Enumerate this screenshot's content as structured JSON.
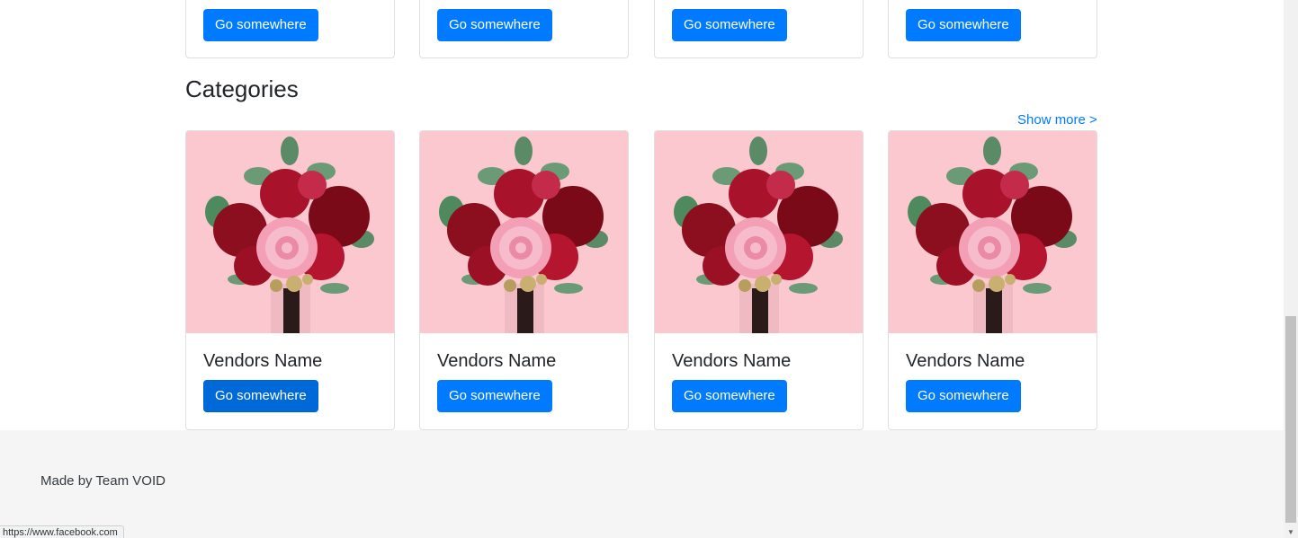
{
  "top_row": {
    "cards": [
      {
        "button": "Go somewhere"
      },
      {
        "button": "Go somewhere"
      },
      {
        "button": "Go somewhere"
      },
      {
        "button": "Go somewhere"
      }
    ]
  },
  "categories": {
    "title": "Categories",
    "show_more": "Show more >",
    "cards": [
      {
        "name": "Vendors Name",
        "button": "Go somewhere",
        "image": "flower-bouquet-image"
      },
      {
        "name": "Vendors Name",
        "button": "Go somewhere",
        "image": "flower-bouquet-image"
      },
      {
        "name": "Vendors Name",
        "button": "Go somewhere",
        "image": "flower-bouquet-image"
      },
      {
        "name": "Vendors Name",
        "button": "Go somewhere",
        "image": "flower-bouquet-image"
      }
    ]
  },
  "footer": {
    "credit": "Made by Team VOID"
  },
  "status_bar": {
    "url": "https://www.facebook.com"
  },
  "colors": {
    "primary": "#007bff",
    "footer_bg": "#f5f5f5",
    "image_bg": "#fbc8cf"
  }
}
